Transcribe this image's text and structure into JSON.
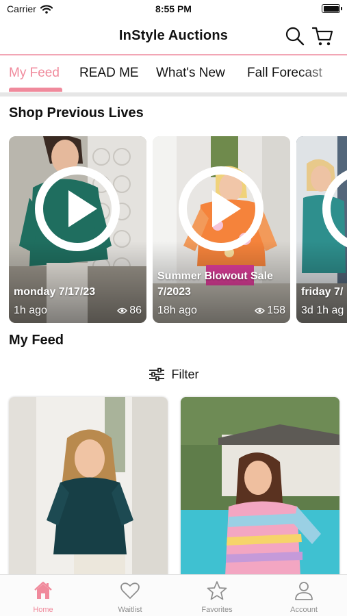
{
  "status_bar": {
    "carrier": "Carrier",
    "time": "8:55 PM",
    "battery_level": 1.0
  },
  "header": {
    "title": "InStyle Auctions",
    "search_icon": "search-icon",
    "cart_icon": "cart-icon"
  },
  "tabs": [
    {
      "label": "My Feed",
      "active": true
    },
    {
      "label": "READ ME",
      "active": false
    },
    {
      "label": "What's New",
      "active": false
    },
    {
      "label": "Fall Forecast",
      "active": false
    }
  ],
  "previous_lives": {
    "title": "Shop Previous Lives",
    "items": [
      {
        "title": "monday 7/17/23",
        "time": "1h ago",
        "views": "86"
      },
      {
        "title": "Summer Blowout Sale 7/2023",
        "time": "18h ago",
        "views": "158"
      },
      {
        "title": "friday 7/",
        "time": "3d 1h ag",
        "views": ""
      }
    ]
  },
  "feed": {
    "title": "My Feed",
    "filter_label": "Filter"
  },
  "bottom_nav": [
    {
      "label": "Home",
      "icon": "home-icon",
      "active": true
    },
    {
      "label": "Waitlist",
      "icon": "heart-icon",
      "active": false
    },
    {
      "label": "Favorites",
      "icon": "star-icon",
      "active": false
    },
    {
      "label": "Account",
      "icon": "user-icon",
      "active": false
    }
  ],
  "colors": {
    "accent": "#f08a9c",
    "divider": "#f2a6b5",
    "muted": "#8e8e8e"
  }
}
